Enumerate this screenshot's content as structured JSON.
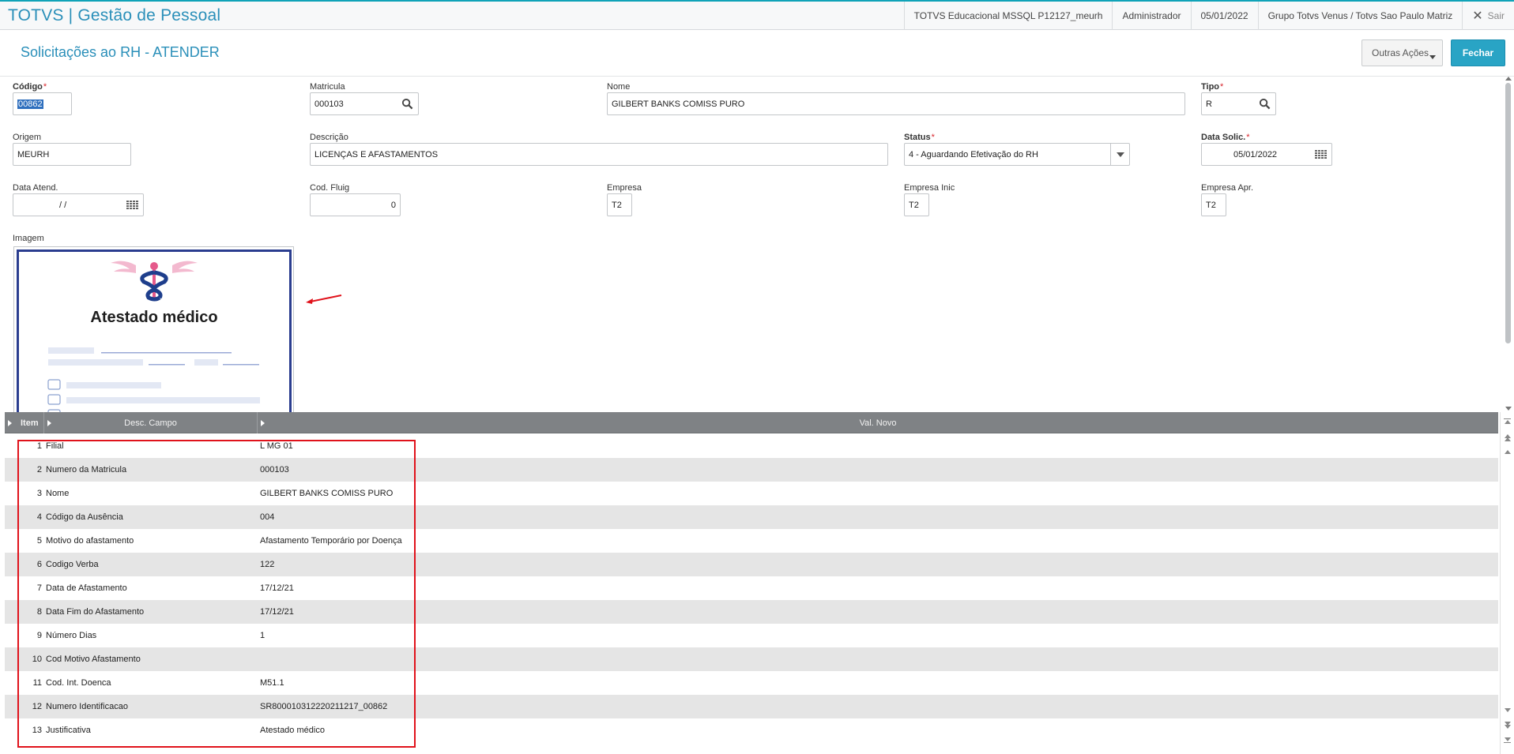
{
  "app": {
    "title": "TOTVS | Gestão de Pessoal"
  },
  "topbar": {
    "environment": "TOTVS Educacional MSSQL P12127_meurh",
    "user": "Administrador",
    "date": "05/01/2022",
    "company": "Grupo Totvs Venus / Totvs Sao Paulo Matriz",
    "logout_label": "Sair"
  },
  "header": {
    "title": "Solicitações ao RH - ATENDER",
    "actions_label": "Outras Ações",
    "close_label": "Fechar"
  },
  "form": {
    "codigo": {
      "label": "Código",
      "value": "00862"
    },
    "matricula": {
      "label": "Matricula",
      "value": "000103"
    },
    "nome": {
      "label": "Nome",
      "value": "GILBERT BANKS COMISS PURO"
    },
    "tipo": {
      "label": "Tipo",
      "value": "R"
    },
    "origem": {
      "label": "Origem",
      "value": "MEURH"
    },
    "descricao": {
      "label": "Descrição",
      "value": "LICENÇAS E AFASTAMENTOS"
    },
    "status": {
      "label": "Status",
      "value": "4 - Aguardando Efetivação do RH"
    },
    "data_solic": {
      "label": "Data Solic.",
      "value": "05/01/2022"
    },
    "data_atend": {
      "label": "Data Atend.",
      "value": "/  /"
    },
    "cod_fluig": {
      "label": "Cod. Fluig",
      "value": "0"
    },
    "empresa": {
      "label": "Empresa",
      "value": "T2"
    },
    "empresa_inic": {
      "label": "Empresa Inic",
      "value": "T2"
    },
    "empresa_apr": {
      "label": "Empresa Apr.",
      "value": "T2"
    },
    "imagem": {
      "label": "Imagem",
      "document_title": "Atestado médico"
    }
  },
  "grid": {
    "columns": [
      "Item",
      "Desc. Campo",
      "Val. Novo"
    ],
    "rows": [
      {
        "item": "1",
        "desc": "Filial",
        "val": "L MG 01"
      },
      {
        "item": "2",
        "desc": "Numero da Matricula",
        "val": "000103"
      },
      {
        "item": "3",
        "desc": "Nome",
        "val": "GILBERT BANKS COMISS PURO"
      },
      {
        "item": "4",
        "desc": "Código da Ausência",
        "val": "004"
      },
      {
        "item": "5",
        "desc": "Motivo do afastamento",
        "val": "Afastamento Temporário por Doença"
      },
      {
        "item": "6",
        "desc": "Codigo Verba",
        "val": "122"
      },
      {
        "item": "7",
        "desc": "Data de Afastamento",
        "val": "17/12/21"
      },
      {
        "item": "8",
        "desc": "Data Fim do Afastamento",
        "val": "17/12/21"
      },
      {
        "item": "9",
        "desc": "Número Dias",
        "val": "1"
      },
      {
        "item": "10",
        "desc": "Cod Motivo Afastamento",
        "val": ""
      },
      {
        "item": "11",
        "desc": "Cod. Int. Doenca",
        "val": "M51.1"
      },
      {
        "item": "12",
        "desc": "Numero Identificacao",
        "val": "SR800010312220211217_00862"
      },
      {
        "item": "13",
        "desc": "Justificativa",
        "val": "Atestado médico"
      }
    ]
  },
  "colors": {
    "brand": "#2a8fb9",
    "primary_button": "#29a4c5",
    "required_star": "#d8232a",
    "highlight_box": "#e0121b",
    "grid_header": "#7f8285"
  }
}
